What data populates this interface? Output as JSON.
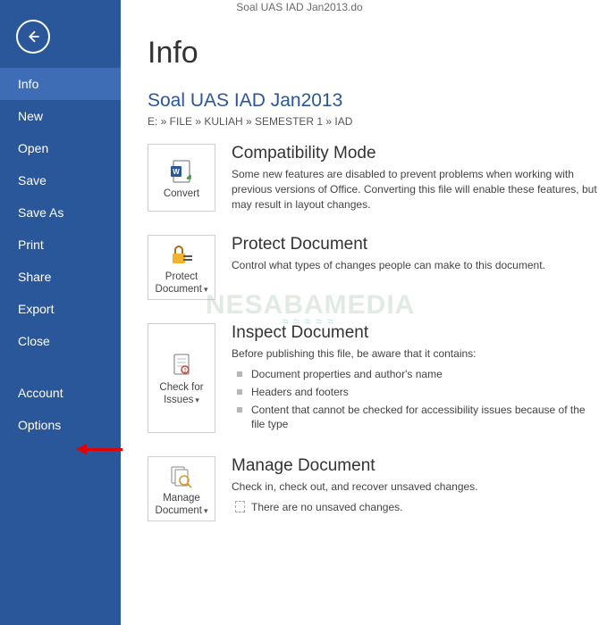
{
  "titlebar": "Soal UAS IAD Jan2013.do",
  "sidebar": {
    "items": [
      {
        "label": "Info",
        "selected": true,
        "name": "nav-info"
      },
      {
        "label": "New",
        "selected": false,
        "name": "nav-new"
      },
      {
        "label": "Open",
        "selected": false,
        "name": "nav-open"
      },
      {
        "label": "Save",
        "selected": false,
        "name": "nav-save"
      },
      {
        "label": "Save As",
        "selected": false,
        "name": "nav-save-as"
      },
      {
        "label": "Print",
        "selected": false,
        "name": "nav-print"
      },
      {
        "label": "Share",
        "selected": false,
        "name": "nav-share"
      },
      {
        "label": "Export",
        "selected": false,
        "name": "nav-export"
      },
      {
        "label": "Close",
        "selected": false,
        "name": "nav-close"
      }
    ],
    "footer": [
      {
        "label": "Account",
        "name": "nav-account"
      },
      {
        "label": "Options",
        "name": "nav-options"
      }
    ]
  },
  "main": {
    "page_title": "Info",
    "doc_title": "Soal UAS IAD Jan2013",
    "breadcrumb": "E: » FILE » KULIAH » SEMESTER 1 » IAD",
    "sections": {
      "convert": {
        "tile_label": "Convert",
        "heading": "Compatibility Mode",
        "desc": "Some new features are disabled to prevent problems when working with previous versions of Office. Converting this file will enable these features, but may result in layout changes."
      },
      "protect": {
        "tile_label_line1": "Protect",
        "tile_label_line2": "Document",
        "heading": "Protect Document",
        "desc": "Control what types of changes people can make to this document."
      },
      "inspect": {
        "tile_label_line1": "Check for",
        "tile_label_line2": "Issues",
        "heading": "Inspect Document",
        "desc": "Before publishing this file, be aware that it contains:",
        "bullets": [
          "Document properties and author's name",
          "Headers and footers",
          "Content that cannot be checked for accessibility issues because of the file type"
        ]
      },
      "manage": {
        "tile_label_line1": "Manage",
        "tile_label_line2": "Document",
        "heading": "Manage Document",
        "desc": "Check in, check out, and recover unsaved changes.",
        "bullets": [
          "There are no unsaved changes."
        ]
      }
    }
  },
  "watermark": "NESABAMEDIA",
  "colors": {
    "brand": "#2A579A",
    "accent_arrow": "#e30000"
  }
}
